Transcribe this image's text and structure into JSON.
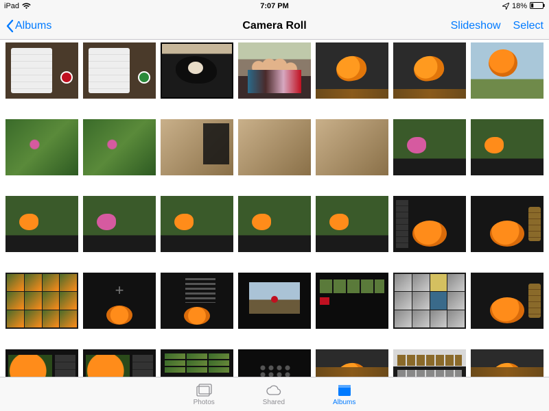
{
  "status": {
    "device": "iPad",
    "time": "7:07 PM",
    "battery_pct": "18%"
  },
  "nav": {
    "back_label": "Albums",
    "title": "Camera Roll",
    "slideshow": "Slideshow",
    "select": "Select"
  },
  "tabs": {
    "photos": "Photos",
    "shared": "Shared",
    "albums": "Albums"
  },
  "colors": {
    "tint": "#007aff"
  },
  "grid": {
    "columns": 7,
    "selected_index": 2
  }
}
